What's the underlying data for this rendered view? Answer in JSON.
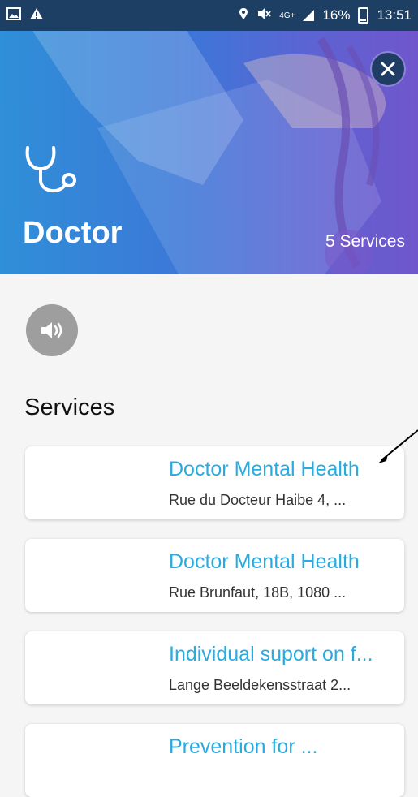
{
  "status_bar": {
    "battery": "16%",
    "time": "13:51",
    "network": "4G+"
  },
  "header": {
    "title": "Doctor",
    "services_count": "5 Services",
    "icon": "stethoscope-icon"
  },
  "section_title": "Services",
  "services": [
    {
      "title": "Doctor Mental Health",
      "address": "Rue du Docteur Haibe 4, ..."
    },
    {
      "title": "Doctor Mental Health",
      "address": "Rue Brunfaut, 18B, 1080 ..."
    },
    {
      "title": "Individual suport on f...",
      "address": "Lange Beeldekensstraat 2..."
    },
    {
      "title": "Prevention for ...",
      "address": ""
    }
  ],
  "colors": {
    "accent": "#29abe2",
    "status_bar": "#1c3f63",
    "close_button": "#1e3c64"
  }
}
